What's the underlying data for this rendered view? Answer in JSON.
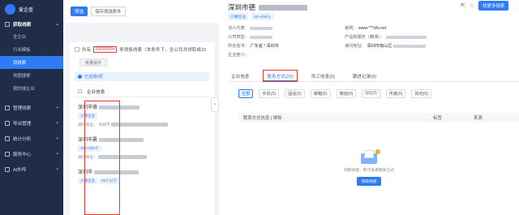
{
  "sidebar": {
    "logo_text": "爱企查",
    "items": [
      {
        "label": "获取线索",
        "type": "group"
      },
      {
        "label": "全企业",
        "type": "sub"
      },
      {
        "label": "行业模板",
        "type": "sub"
      },
      {
        "label": "找线索",
        "type": "sub",
        "active": true
      },
      {
        "label": "地图搜索",
        "type": "sub"
      },
      {
        "label": "我的搜企业",
        "type": "sub"
      },
      {
        "label": "管理线索",
        "type": "group"
      },
      {
        "label": "导出管理",
        "type": "group"
      },
      {
        "label": "统计分析",
        "type": "group"
      },
      {
        "label": "服务中心",
        "type": "group"
      },
      {
        "label": "AI外呼",
        "type": "group"
      }
    ]
  },
  "main": {
    "filter_button": "筛选",
    "save_filter_button": "保存筛选条件",
    "count_prefix": "共有",
    "count_value": "1000000+",
    "count_suffix": "条销售线索（本条件下，全公司共领取或10",
    "batch_button": "批量操作",
    "selected_text": "已选择0项",
    "table_header": "企业信息",
    "rows": [
      {
        "name_prefix": "深圳市德",
        "tag": "小微企业",
        "addr_label": "通讯地址：",
        "addr_tail": "深圳市"
      },
      {
        "name_prefix": "深圳市晨",
        "tag": "100~500人",
        "addr_label": "通讯地址：",
        "addr_tail": ""
      },
      {
        "name_prefix": "深圳市",
        "tag": "小微企业",
        "tag2": "50人以下",
        "addr_label": "",
        "addr_tail": ""
      }
    ]
  },
  "drawer": {
    "title_prefix": "深圳市德",
    "chips": [
      "小微企业",
      "50~100人"
    ],
    "find_button": "找更多线索",
    "info": {
      "legal_label": "法人代表：",
      "website_label": "官网：",
      "website_value": "www.***ofo.net",
      "company_type_label": "公司类型：",
      "product_label": "产品和服务（精准）：",
      "region_label": "所在省市：",
      "region_value": "广东省 / 深圳市",
      "address_label": "通讯地址：",
      "address_value": "深圳市南山区",
      "manager_label": "企业管介："
    },
    "tabs": [
      "企业信息",
      "联系方式(20)",
      "员工信息(0)",
      "跟进记录(0)"
    ],
    "filters": [
      "全部",
      "手机(5)",
      "固话(5)",
      "邮箱(5)",
      "微信(0)",
      "QQ(2)",
      "传真(0)",
      "其他(0)"
    ],
    "contact_table": {
      "col1": "联系方式信息 | 排除",
      "col2": "标签",
      "col3": "来源"
    },
    "empty_message": "领取线索，即可查看联系方式",
    "claim_button": "领取线索"
  },
  "colors": {
    "accent": "#2f7bf5",
    "highlight_red": "#e03a2f",
    "sidebar_bg": "#1f2d48"
  }
}
